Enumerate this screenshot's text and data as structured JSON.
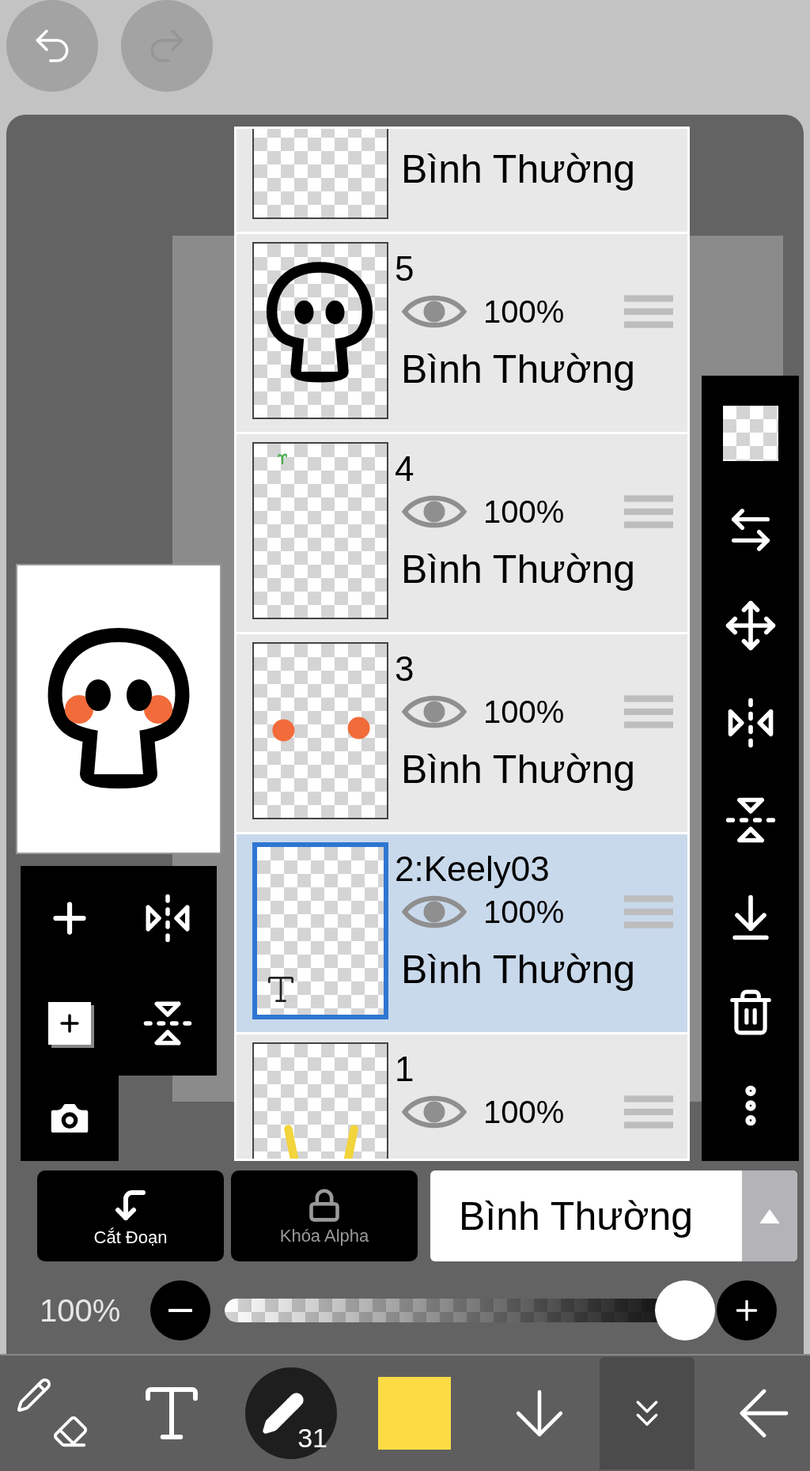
{
  "history": {
    "undo_disabled": false,
    "redo_disabled": true
  },
  "layers": [
    {
      "kind": "empty",
      "blend": "Bình Thường",
      "selected": false
    },
    {
      "name": "5",
      "kind": "skull",
      "opacity": "100%",
      "blend": "Bình Thường",
      "selected": false
    },
    {
      "name": "4",
      "kind": "sprout",
      "opacity": "100%",
      "blend": "Bình Thường",
      "selected": false
    },
    {
      "name": "3",
      "kind": "blush",
      "opacity": "100%",
      "blend": "Bình Thường",
      "selected": false
    },
    {
      "name": "2:Keely03",
      "kind": "text",
      "opacity": "100%",
      "blend": "Bình Thường",
      "selected": true
    },
    {
      "name": "1",
      "kind": "stripes",
      "opacity": "100%",
      "selected": false
    }
  ],
  "layer_actions": [
    {
      "kind": "clip",
      "label": "Cắt Đoạn",
      "disabled": false
    },
    {
      "kind": "alpha_lock",
      "label": "Khóa Alpha",
      "disabled": true
    }
  ],
  "blend_mode": {
    "value": "Bình Thường"
  },
  "opacity": {
    "reading": "100%",
    "level": 1
  },
  "brush": {
    "size": "31",
    "color": "#fbdc45"
  }
}
